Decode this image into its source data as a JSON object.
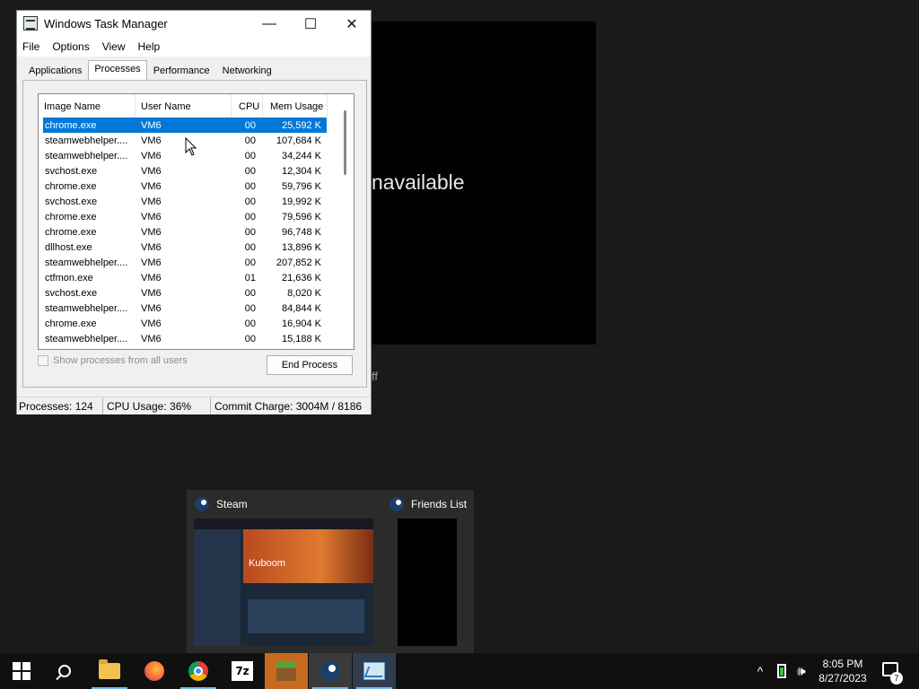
{
  "background_app": {
    "message_fragment": "navailable",
    "small_fragment": "ff"
  },
  "task_manager": {
    "title": "Windows Task Manager",
    "window_buttons": {
      "minimize": "—",
      "maximize": "☐",
      "close": "✕"
    },
    "menu": [
      "File",
      "Options",
      "View",
      "Help"
    ],
    "tabs": [
      "Applications",
      "Processes",
      "Performance",
      "Networking"
    ],
    "active_tab": "Processes",
    "columns": [
      "Image Name",
      "User Name",
      "CPU",
      "Mem Usage"
    ],
    "processes": [
      {
        "name": "chrome.exe",
        "user": "VM6",
        "cpu": "00",
        "mem": "25,592 K"
      },
      {
        "name": "steamwebhelper....",
        "user": "VM6",
        "cpu": "00",
        "mem": "107,684 K"
      },
      {
        "name": "steamwebhelper....",
        "user": "VM6",
        "cpu": "00",
        "mem": "34,244 K"
      },
      {
        "name": "svchost.exe",
        "user": "VM6",
        "cpu": "00",
        "mem": "12,304 K"
      },
      {
        "name": "chrome.exe",
        "user": "VM6",
        "cpu": "00",
        "mem": "59,796 K"
      },
      {
        "name": "svchost.exe",
        "user": "VM6",
        "cpu": "00",
        "mem": "19,992 K"
      },
      {
        "name": "chrome.exe",
        "user": "VM6",
        "cpu": "00",
        "mem": "79,596 K"
      },
      {
        "name": "chrome.exe",
        "user": "VM6",
        "cpu": "00",
        "mem": "96,748 K"
      },
      {
        "name": "dllhost.exe",
        "user": "VM6",
        "cpu": "00",
        "mem": "13,896 K"
      },
      {
        "name": "steamwebhelper....",
        "user": "VM6",
        "cpu": "00",
        "mem": "207,852 K"
      },
      {
        "name": "ctfmon.exe",
        "user": "VM6",
        "cpu": "01",
        "mem": "21,636 K"
      },
      {
        "name": "svchost.exe",
        "user": "VM6",
        "cpu": "00",
        "mem": "8,020 K"
      },
      {
        "name": "steamwebhelper....",
        "user": "VM6",
        "cpu": "00",
        "mem": "84,844 K"
      },
      {
        "name": "chrome.exe",
        "user": "VM6",
        "cpu": "00",
        "mem": "16,904 K"
      },
      {
        "name": "steamwebhelper....",
        "user": "VM6",
        "cpu": "00",
        "mem": "15,188 K"
      }
    ],
    "show_all_label": "Show processes from all users",
    "end_process_label": "End Process",
    "status": {
      "processes": "Processes: 124",
      "cpu": "CPU Usage: 36%",
      "commit": "Commit Charge: 3004M / 8186"
    }
  },
  "preview": {
    "steam_title": "Steam",
    "friends_title": "Friends List",
    "steam_thumb_text": "Kuboom"
  },
  "taskbar": {
    "sevenzip_label": "7z",
    "time": "8:05 PM",
    "date": "8/27/2023",
    "notification_count": "7",
    "tray_chevron": "^",
    "volume_glyph": "🕪"
  }
}
